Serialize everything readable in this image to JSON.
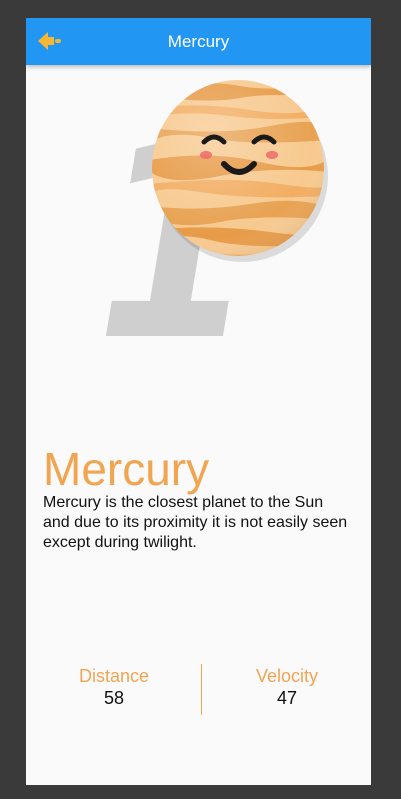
{
  "appbar": {
    "title": "Mercury",
    "back_icon": "arrow-left-icon",
    "color": "#2196f3"
  },
  "planet": {
    "number": "1",
    "name": "Mercury",
    "description": "Mercury is the closest planet to the Sun and due to its proximity it is not easily seen except during twilight.",
    "accent_color": "#f2a550"
  },
  "stats": [
    {
      "label": "Distance",
      "value": "58"
    },
    {
      "label": "Velocity",
      "value": "47"
    }
  ]
}
